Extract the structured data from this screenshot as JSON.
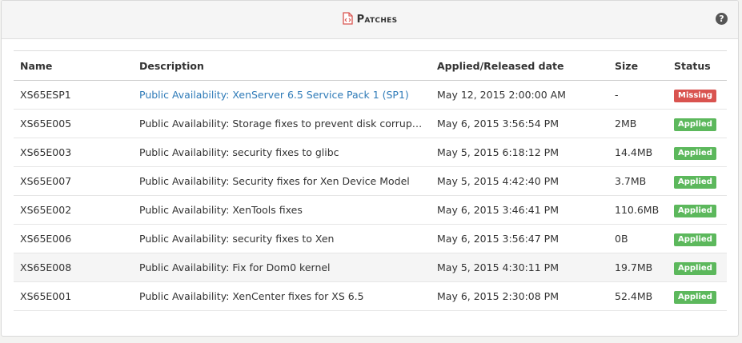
{
  "panel": {
    "title": "Patches",
    "help_icon": "?"
  },
  "columns": [
    "Name",
    "Description",
    "Applied/Released date",
    "Size",
    "Status"
  ],
  "rows": [
    {
      "name": "XS65ESP1",
      "description": "Public Availability: XenServer 6.5 Service Pack 1 (SP1)",
      "date": "May 12, 2015 2:00:00 AM",
      "size": "-",
      "status": "Missing"
    },
    {
      "name": "XS65E005",
      "description": "Public Availability: Storage fixes to prevent disk corrup…",
      "date": "May 6, 2015 3:56:54 PM",
      "size": "2MB",
      "status": "Applied"
    },
    {
      "name": "XS65E003",
      "description": "Public Availability: security fixes to glibc",
      "date": "May 5, 2015 6:18:12 PM",
      "size": "14.4MB",
      "status": "Applied"
    },
    {
      "name": "XS65E007",
      "description": "Public Availability: Security fixes for Xen Device Model",
      "date": "May 5, 2015 4:42:40 PM",
      "size": "3.7MB",
      "status": "Applied"
    },
    {
      "name": "XS65E002",
      "description": "Public Availability: XenTools fixes",
      "date": "May 6, 2015 3:46:41 PM",
      "size": "110.6MB",
      "status": "Applied"
    },
    {
      "name": "XS65E006",
      "description": "Public Availability: security fixes to Xen",
      "date": "May 6, 2015 3:56:47 PM",
      "size": "0B",
      "status": "Applied"
    },
    {
      "name": "XS65E008",
      "description": "Public Availability: Fix for Dom0 kernel",
      "date": "May 5, 2015 4:30:11 PM",
      "size": "19.7MB",
      "status": "Applied"
    },
    {
      "name": "XS65E001",
      "description": "Public Availability: XenCenter fixes for XS 6.5",
      "date": "May 6, 2015 2:30:08 PM",
      "size": "52.4MB",
      "status": "Applied"
    }
  ],
  "colors": {
    "applied": "#5cb85c",
    "missing": "#d9534f",
    "link": "#2f7bb8"
  }
}
